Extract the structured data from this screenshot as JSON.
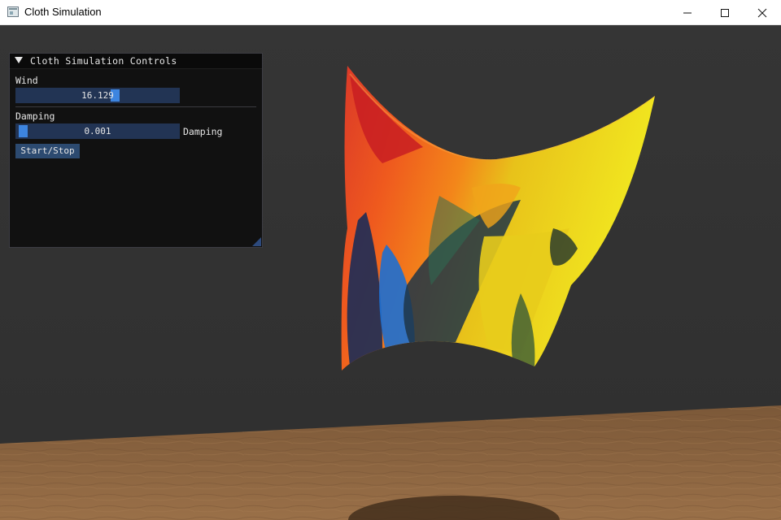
{
  "window": {
    "title": "Cloth Simulation",
    "icon": "app-window-icon",
    "controls": [
      "minimize-icon",
      "maximize-icon",
      "close-icon"
    ]
  },
  "panel": {
    "title": "Cloth Simulation Controls",
    "wind": {
      "label": "Wind",
      "value": "16.129",
      "level": 0.62
    },
    "damping": {
      "label": "Damping",
      "value": "0.001",
      "side_label": "Damping",
      "level": 0.0
    },
    "button_label": "Start/Stop"
  },
  "colors": {
    "background": "#333333",
    "panel": "#0f0f0f",
    "slider": "#223454",
    "slider_grab": "#3d85e0",
    "button": "#2c4a70",
    "floor": "#8a6541"
  }
}
